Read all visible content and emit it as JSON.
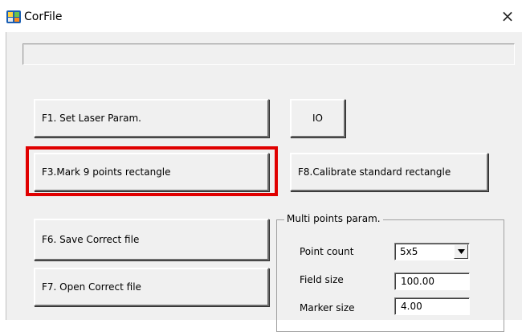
{
  "window": {
    "title": "CorFile",
    "close_glyph": "×",
    "icon": "corfile-app-icon"
  },
  "status_bar": {
    "text": ""
  },
  "buttons": {
    "f1": "F1. Set Laser Param.",
    "io": "IO",
    "f3": "F3.Mark 9 points rectangle",
    "f8": "F8.Calibrate standard rectangle",
    "f6": "F6. Save Correct file",
    "f7": "F7. Open Correct file"
  },
  "highlight": {
    "target": "f3",
    "color": "#e00000"
  },
  "multi_points": {
    "title": "Multi points param.",
    "point_count_label": "Point count",
    "point_count_value": "5x5",
    "field_size_label": "Field size",
    "field_size_value": "100.00",
    "marker_size_label": "Marker size",
    "marker_size_value": "4.00"
  }
}
